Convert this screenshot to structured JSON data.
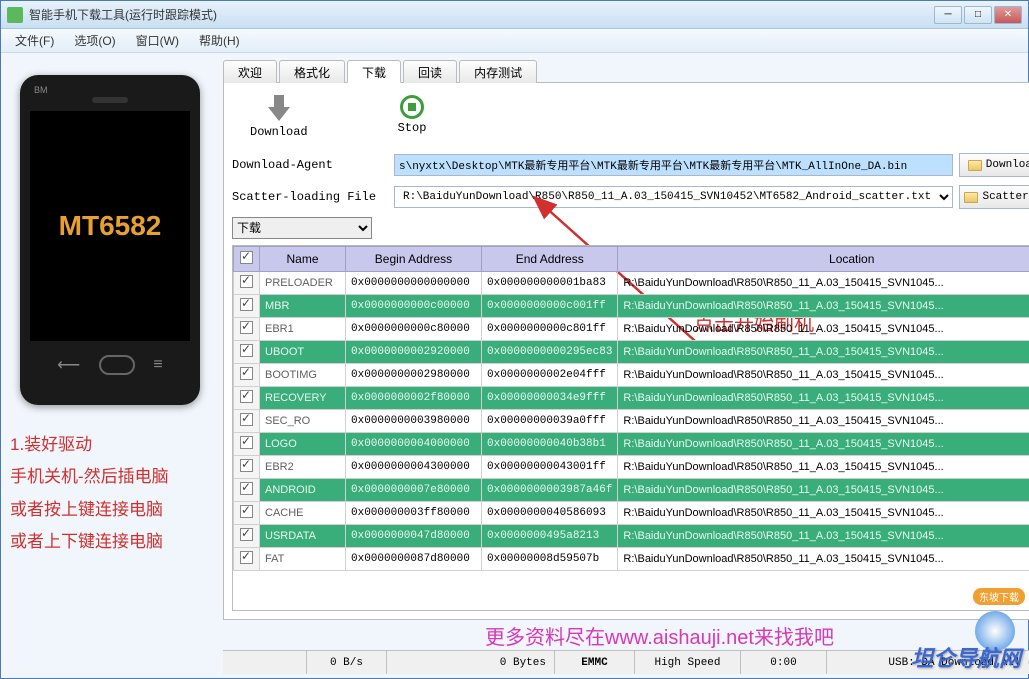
{
  "window": {
    "title": "智能手机下载工具(运行时跟踪模式)"
  },
  "menus": [
    "文件(F)",
    "选项(O)",
    "窗口(W)",
    "帮助(H)"
  ],
  "phone": {
    "model": "MT6582",
    "bm": "BM"
  },
  "instructions": {
    "line1": "1.装好驱动",
    "line2": "手机关机-然后插电脑",
    "line3": "或者按上键连接电脑",
    "line4": "或者上下键连接电脑"
  },
  "tabs": {
    "items": [
      "欢迎",
      "格式化",
      "下载",
      "回读",
      "内存测试"
    ],
    "active": 2
  },
  "toolbar": {
    "download": "Download",
    "stop": "Stop"
  },
  "annotation": {
    "click_start": "点击开始刷机"
  },
  "form": {
    "da_label": "Download-Agent",
    "da_value": "s\\nyxtx\\Desktop\\MTK最新专用平台\\MTK最新专用平台\\MTK最新专用平台\\MTK_AllInOne_DA.bin",
    "da_btn": "Download Agent",
    "scatter_label": "Scatter-loading File",
    "scatter_value": "R:\\BaiduYunDownload\\R850\\R850_11_A.03_150415_SVN10452\\MT6582_Android_scatter.txt",
    "scatter_btn": "Scatter-loading",
    "mode": "下载"
  },
  "table": {
    "headers": {
      "name": "Name",
      "begin": "Begin Address",
      "end": "End Address",
      "location": "Location"
    },
    "rows": [
      {
        "green": false,
        "name": "PRELOADER",
        "begin": "0x0000000000000000",
        "end": "0x000000000001ba83",
        "loc": "R:\\BaiduYunDownload\\R850\\R850_11_A.03_150415_SVN1045..."
      },
      {
        "green": true,
        "name": "MBR",
        "begin": "0x0000000000c00000",
        "end": "0x0000000000c001ff",
        "loc": "R:\\BaiduYunDownload\\R850\\R850_11_A.03_150415_SVN1045..."
      },
      {
        "green": false,
        "name": "EBR1",
        "begin": "0x0000000000c80000",
        "end": "0x0000000000c801ff",
        "loc": "R:\\BaiduYunDownload\\R850\\R850_11_A.03_150415_SVN1045..."
      },
      {
        "green": true,
        "name": "UBOOT",
        "begin": "0x0000000002920000",
        "end": "0x0000000000295ec83",
        "loc": "R:\\BaiduYunDownload\\R850\\R850_11_A.03_150415_SVN1045..."
      },
      {
        "green": false,
        "name": "BOOTIMG",
        "begin": "0x0000000002980000",
        "end": "0x0000000002e04fff",
        "loc": "R:\\BaiduYunDownload\\R850\\R850_11_A.03_150415_SVN1045..."
      },
      {
        "green": true,
        "name": "RECOVERY",
        "begin": "0x0000000002f80000",
        "end": "0x00000000034e9fff",
        "loc": "R:\\BaiduYunDownload\\R850\\R850_11_A.03_150415_SVN1045..."
      },
      {
        "green": false,
        "name": "SEC_RO",
        "begin": "0x0000000003980000",
        "end": "0x00000000039a0fff",
        "loc": "R:\\BaiduYunDownload\\R850\\R850_11_A.03_150415_SVN1045..."
      },
      {
        "green": true,
        "name": "LOGO",
        "begin": "0x0000000004000000",
        "end": "0x00000000040b38b1",
        "loc": "R:\\BaiduYunDownload\\R850\\R850_11_A.03_150415_SVN1045..."
      },
      {
        "green": false,
        "name": "EBR2",
        "begin": "0x0000000004300000",
        "end": "0x00000000043001ff",
        "loc": "R:\\BaiduYunDownload\\R850\\R850_11_A.03_150415_SVN1045..."
      },
      {
        "green": true,
        "name": "ANDROID",
        "begin": "0x0000000007e80000",
        "end": "0x0000000003987a46f",
        "loc": "R:\\BaiduYunDownload\\R850\\R850_11_A.03_150415_SVN1045..."
      },
      {
        "green": false,
        "name": "CACHE",
        "begin": "0x000000003ff80000",
        "end": "0x0000000040586093",
        "loc": "R:\\BaiduYunDownload\\R850\\R850_11_A.03_150415_SVN1045..."
      },
      {
        "green": true,
        "name": "USRDATA",
        "begin": "0x0000000047d80000",
        "end": "0x0000000495a8213",
        "loc": "R:\\BaiduYunDownload\\R850\\R850_11_A.03_150415_SVN1045..."
      },
      {
        "green": false,
        "name": "FAT",
        "begin": "0x0000000087d80000",
        "end": "0x00000008d59507b",
        "loc": "R:\\BaiduYunDownload\\R850\\R850_11_A.03_150415_SVN1045..."
      }
    ]
  },
  "footer_banner": "更多资料尽在www.aishauji.net来找我吧",
  "statusbar": {
    "speed": "0 B/s",
    "bytes": "0 Bytes",
    "storage": "EMMC",
    "usb_speed": "High Speed",
    "time": "0:00",
    "usb": "USB: DA Download All ("
  },
  "watermark": {
    "text": "坦仑导航网",
    "tag": "东坡下载"
  }
}
